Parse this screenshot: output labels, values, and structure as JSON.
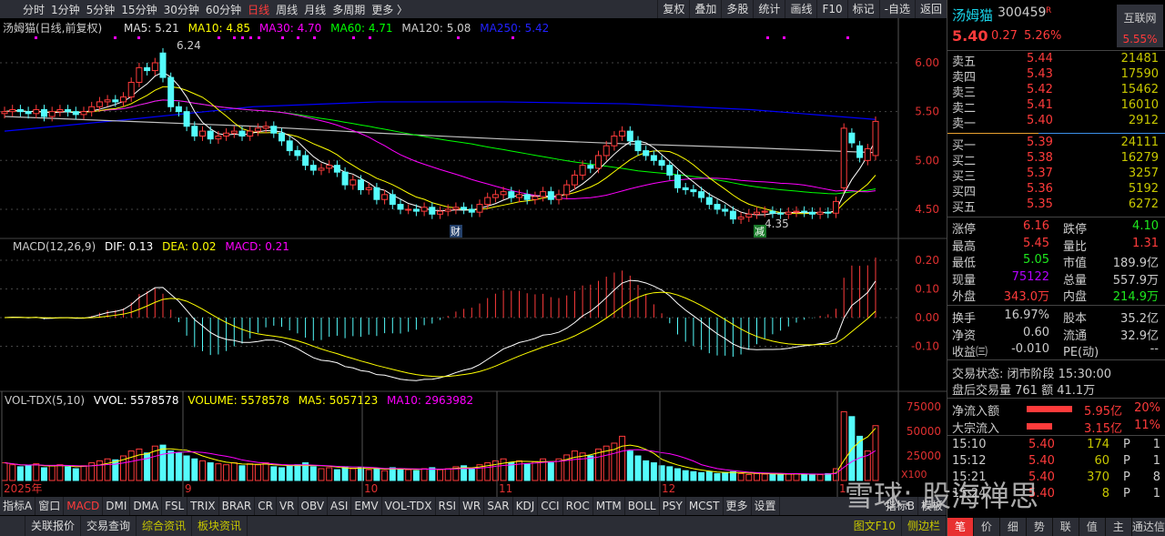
{
  "topbar": {
    "periods": [
      "分时",
      "1分钟",
      "5分钟",
      "15分钟",
      "30分钟",
      "60分钟",
      "日线",
      "周线",
      "月线",
      "多周期",
      "更多 〉"
    ],
    "active": 6,
    "tools": [
      "复权",
      "叠加",
      "多股",
      "统计",
      "画线",
      "F10",
      "标记",
      "-自选",
      "返回"
    ]
  },
  "main_legend": {
    "title": "汤姆猫(日线,前复权)",
    "ma5": "MA5: 5.21",
    "ma10": "MA10: 4.85",
    "ma30": "MA30: 4.70",
    "ma60": "MA60: 4.71",
    "ma120": "MA120: 5.08",
    "ma250": "MA250: 5.42"
  },
  "macd_legend": {
    "title": "MACD(12,26,9)",
    "dif": "DIF: 0.13",
    "dea": "DEA: 0.02",
    "macd": "MACD: 0.21"
  },
  "vol_legend": {
    "title": "VOL-TDX(5,10)",
    "vvol": "VVOL: 5578578",
    "volume": "VOLUME: 5578578",
    "ma5": "MA5: 5057123",
    "ma10": "MA10: 2963982"
  },
  "colors": {
    "up": "#ff3b3b",
    "down": "#54fcfc",
    "ma5": "#ffffff",
    "ma10": "#ffff00",
    "ma30": "#ff00ff",
    "ma60": "#00ff00",
    "ma120": "#c0c0c0",
    "ma250": "#0000ff"
  },
  "chart_data": [
    {
      "type": "candlestick",
      "title": "汤姆猫(日线,前复权)",
      "y_ticks": [
        "6.00",
        "5.50",
        "5.00",
        "4.50"
      ],
      "ylim": [
        4.25,
        6.45
      ],
      "high_label": "6.24",
      "low_label": "4.35",
      "markers": [
        "财",
        "减"
      ],
      "x_labels": [
        "2025年",
        "9",
        "10",
        "11",
        "12",
        "1"
      ],
      "close": [
        5.5,
        5.52,
        5.5,
        5.48,
        5.52,
        5.45,
        5.5,
        5.52,
        5.5,
        5.47,
        5.5,
        5.55,
        5.6,
        5.62,
        5.6,
        5.65,
        5.8,
        5.95,
        5.92,
        6.0,
        5.85,
        5.55,
        5.5,
        5.35,
        5.25,
        5.3,
        5.22,
        5.25,
        5.28,
        5.3,
        5.25,
        5.3,
        5.33,
        5.35,
        5.28,
        5.2,
        5.1,
        5.05,
        4.95,
        4.9,
        4.92,
        4.95,
        4.88,
        4.75,
        4.8,
        4.7,
        4.72,
        4.6,
        4.65,
        4.55,
        4.5,
        4.5,
        4.48,
        4.52,
        4.45,
        4.48,
        4.5,
        4.52,
        4.5,
        4.47,
        4.55,
        4.62,
        4.65,
        4.68,
        4.62,
        4.65,
        4.6,
        4.63,
        4.68,
        4.6,
        4.65,
        4.75,
        4.85,
        4.95,
        4.92,
        5.05,
        5.15,
        5.25,
        5.3,
        5.2,
        5.1,
        5.05,
        5.0,
        4.95,
        4.85,
        4.72,
        4.7,
        4.68,
        4.62,
        4.55,
        4.5,
        4.48,
        4.4,
        4.42,
        4.45,
        4.47,
        4.48,
        4.46,
        4.45,
        4.47,
        4.48,
        4.47,
        4.45,
        4.47,
        4.46,
        4.58,
        5.33,
        5.18,
        5.03,
        5.12,
        5.4
      ],
      "open_overrides": {
        "106": 4.72,
        "107": 5.28,
        "108": 5.15,
        "109": 5.0,
        "110": 5.05,
        "20": 6.1
      },
      "ma120": [
        5.45,
        5.4,
        5.35,
        5.28,
        5.22,
        5.17,
        5.13,
        5.08
      ],
      "ma250": [
        5.3,
        5.42,
        5.55,
        5.6,
        5.6,
        5.58,
        5.52,
        5.42
      ]
    },
    {
      "type": "bar+line",
      "title": "MACD(12,26,9)",
      "y_ticks": [
        "0.20",
        "0.10",
        "0.00",
        "-0.10"
      ],
      "ylim": [
        -0.22,
        0.24
      ]
    },
    {
      "type": "bar",
      "title": "VOL-TDX(5,10)",
      "y_ticks": [
        "75000",
        "50000",
        "25000"
      ],
      "unit": "X100",
      "ylim": [
        0,
        85000
      ],
      "volume": [
        18000,
        16000,
        14000,
        15000,
        17000,
        13000,
        15000,
        16000,
        14000,
        12000,
        15000,
        18000,
        20000,
        22000,
        21000,
        25000,
        30000,
        32000,
        28000,
        35000,
        36000,
        30000,
        28000,
        25000,
        22000,
        20000,
        18000,
        17000,
        16000,
        18000,
        15000,
        17000,
        16000,
        18000,
        14000,
        13000,
        15000,
        16000,
        18000,
        14000,
        12000,
        13000,
        11000,
        14000,
        12000,
        13000,
        11000,
        12000,
        10000,
        13000,
        12000,
        11000,
        10000,
        12000,
        13000,
        11000,
        12000,
        14000,
        15000,
        12000,
        16000,
        18000,
        20000,
        22000,
        18000,
        20000,
        17000,
        19000,
        22000,
        18000,
        22000,
        26000,
        30000,
        28000,
        25000,
        32000,
        35000,
        38000,
        45000,
        30000,
        25000,
        20000,
        18000,
        15000,
        14000,
        12000,
        10000,
        9000,
        8000,
        9000,
        7000,
        8000,
        9000,
        7000,
        6000,
        7000,
        6500,
        7000,
        6000,
        6500,
        7000,
        6000,
        6500,
        6000,
        7000,
        12000,
        70000,
        65000,
        45000,
        30000,
        55786
      ]
    }
  ],
  "quote": {
    "name": "汤姆猫",
    "code": "300459",
    "r_tag": "R",
    "price": "5.40",
    "change": "0.27",
    "pct": "5.26%",
    "sector": "互联网",
    "sector_pct": "5.55%",
    "sells": [
      {
        "l": "卖五",
        "p": "5.44",
        "v": "21481"
      },
      {
        "l": "卖四",
        "p": "5.43",
        "v": "17590"
      },
      {
        "l": "卖三",
        "p": "5.42",
        "v": "15462"
      },
      {
        "l": "卖二",
        "p": "5.41",
        "v": "16010"
      },
      {
        "l": "卖一",
        "p": "5.40",
        "v": "2912"
      }
    ],
    "buys": [
      {
        "l": "买一",
        "p": "5.39",
        "v": "24111"
      },
      {
        "l": "买二",
        "p": "5.38",
        "v": "16279"
      },
      {
        "l": "买三",
        "p": "5.37",
        "v": "3257"
      },
      {
        "l": "买四",
        "p": "5.36",
        "v": "5192"
      },
      {
        "l": "买五",
        "p": "5.35",
        "v": "6272"
      }
    ],
    "stats": [
      [
        "涨停",
        "6.16",
        "red",
        "跌停",
        "4.10",
        "green"
      ],
      [
        "最高",
        "5.45",
        "red",
        "量比",
        "1.31",
        "red"
      ],
      [
        "最低",
        "5.05",
        "green",
        "市值",
        "189.9亿",
        "wht"
      ],
      [
        "现量",
        "75122",
        "mag",
        "总量",
        "557.9万",
        "wht"
      ],
      [
        "外盘",
        "343.0万",
        "red",
        "内盘",
        "214.9万",
        "green"
      ]
    ],
    "stats2": [
      [
        "换手",
        "16.97%",
        "wht",
        "股本",
        "35.2亿",
        "wht"
      ],
      [
        "净资",
        "0.60",
        "wht",
        "流通",
        "32.9亿",
        "wht"
      ],
      [
        "收益㈢",
        "-0.010",
        "wht",
        "PE(动)",
        "--",
        "wht"
      ]
    ],
    "status": "交易状态: 闭市阶段 15:30:00",
    "after": "盘后交易量 761 额 41.1万",
    "flows": [
      {
        "l": "净流入额",
        "v": "5.95亿",
        "p": "20%",
        "frac": 0.2
      },
      {
        "l": "大宗流入",
        "v": "3.15亿",
        "p": "11%",
        "frac": 0.11
      }
    ],
    "ticks": [
      [
        "15:10",
        "5.40",
        "174",
        "P",
        "1"
      ],
      [
        "15:12",
        "5.40",
        "60",
        "P",
        "1"
      ],
      [
        "15:21",
        "5.40",
        "370",
        "P",
        "8"
      ],
      [
        "15:24",
        "5.40",
        "8",
        "P",
        "1"
      ]
    ],
    "tabs": [
      "笔",
      "价",
      "细",
      "势",
      "联",
      "值",
      "主"
    ],
    "tab_extra": "通达信"
  },
  "indicators": [
    "指标A",
    "窗口",
    "MACD",
    "DMI",
    "DMA",
    "FSL",
    "TRIX",
    "BRAR",
    "CR",
    "VR",
    "OBV",
    "ASI",
    "EMV",
    "VOL-TDX",
    "RSI",
    "WR",
    "SAR",
    "KDJ",
    "CCI",
    "ROC",
    "MTM",
    "BOLL",
    "PSY",
    "MCST",
    "更多",
    "设置"
  ],
  "indicators_right": [
    "指标B",
    "模板"
  ],
  "bottom": [
    "关联报价",
    "交易查询",
    "综合资讯",
    "板块资讯"
  ],
  "bottom_right": [
    "图文F10",
    "侧边栏"
  ],
  "watermark": "雪球: 股海禅思"
}
